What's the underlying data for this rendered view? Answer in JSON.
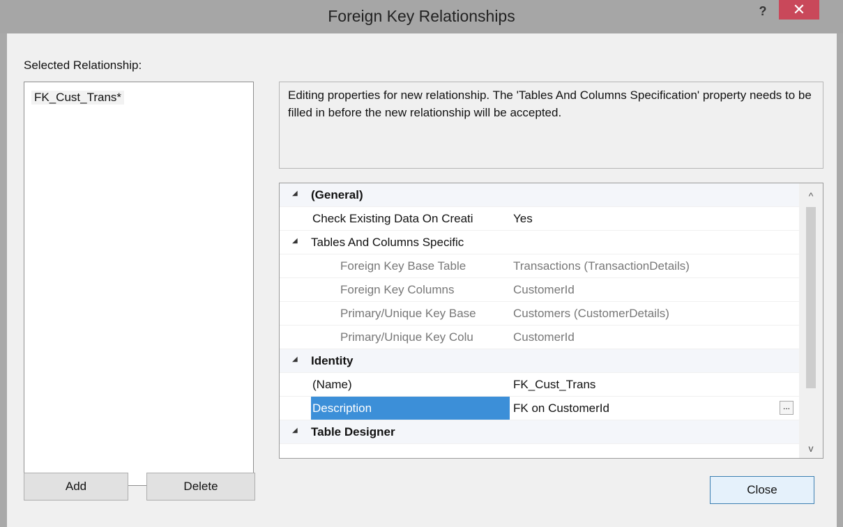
{
  "window": {
    "title": "Foreign Key Relationships",
    "help": "?",
    "close": "✕"
  },
  "selected_relationship": {
    "label": "Selected Relationship:",
    "items": [
      "FK_Cust_Trans*"
    ]
  },
  "description": "Editing properties for new relationship.  The 'Tables And Columns Specification' property needs to be filled in before the new relationship will be accepted.",
  "properties": [
    {
      "type": "category",
      "name": "(General)",
      "toggle": "◢"
    },
    {
      "type": "prop",
      "name": "Check Existing Data On Creati",
      "value": "Yes"
    },
    {
      "type": "category",
      "name": "Tables And Columns Specific",
      "toggle": "◢",
      "inline": true
    },
    {
      "type": "sub",
      "name": "Foreign Key Base Table",
      "value": "Transactions (TransactionDetails)"
    },
    {
      "type": "sub",
      "name": "Foreign Key Columns",
      "value": "CustomerId"
    },
    {
      "type": "sub",
      "name": "Primary/Unique Key Base",
      "value": "Customers (CustomerDetails)"
    },
    {
      "type": "sub",
      "name": "Primary/Unique Key Colu",
      "value": "CustomerId"
    },
    {
      "type": "category",
      "name": "Identity",
      "toggle": "◢"
    },
    {
      "type": "prop",
      "name": "(Name)",
      "value": "FK_Cust_Trans"
    },
    {
      "type": "prop",
      "name": "Description",
      "value": "FK on CustomerId",
      "selected": true,
      "ellipsis": "..."
    },
    {
      "type": "category",
      "name": "Table Designer",
      "toggle": "◢"
    }
  ],
  "scroll": {
    "up": "^",
    "down": "v"
  },
  "buttons": {
    "add": "Add",
    "delete": "Delete",
    "close": "Close"
  }
}
